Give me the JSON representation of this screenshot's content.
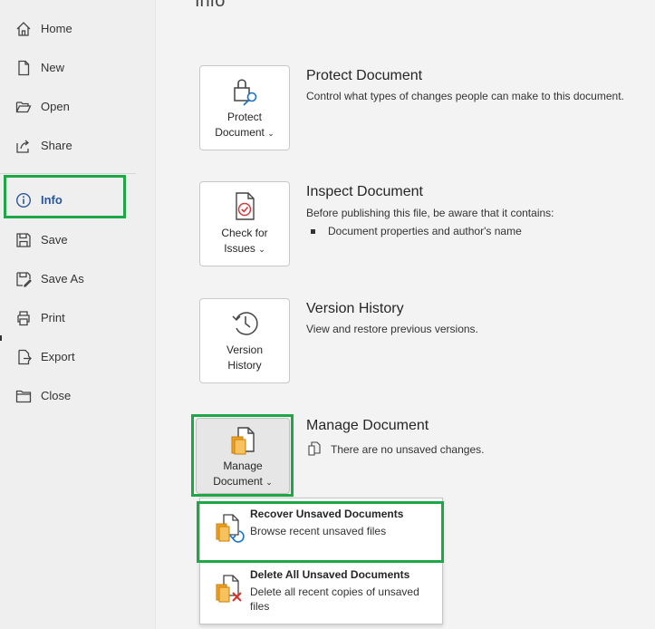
{
  "sidebar": {
    "items": [
      {
        "label": "Home",
        "icon": "home-icon"
      },
      {
        "label": "New",
        "icon": "new-document-icon"
      },
      {
        "label": "Open",
        "icon": "folder-open-icon"
      },
      {
        "label": "Share",
        "icon": "share-icon"
      },
      {
        "label": "Info",
        "icon": "info-icon",
        "active": true
      },
      {
        "label": "Save",
        "icon": "save-icon"
      },
      {
        "label": "Save As",
        "icon": "save-as-icon"
      },
      {
        "label": "Print",
        "icon": "print-icon"
      },
      {
        "label": "Export",
        "icon": "export-icon"
      },
      {
        "label": "Close",
        "icon": "close-folder-icon"
      }
    ]
  },
  "main": {
    "page_title": "Info",
    "sections": {
      "protect": {
        "button_line1": "Protect",
        "button_line2": "Document",
        "title": "Protect Document",
        "description": "Control what types of changes people can make to this document."
      },
      "inspect": {
        "button_line1": "Check for",
        "button_line2": "Issues",
        "title": "Inspect Document",
        "description": "Before publishing this file, be aware that it contains:",
        "bullet": "Document properties and author's name"
      },
      "version": {
        "button_line1": "Version",
        "button_line2": "History",
        "title": "Version History",
        "description": "View and restore previous versions."
      },
      "manage": {
        "button_line1": "Manage",
        "button_line2": "Document",
        "title": "Manage Document",
        "description": "There are no unsaved changes."
      }
    },
    "dropdown": {
      "recover": {
        "title": "Recover Unsaved Documents",
        "description": "Browse recent unsaved files"
      },
      "delete": {
        "title": "Delete All Unsaved Documents",
        "description": "Delete all recent copies of unsaved files"
      }
    }
  },
  "colors": {
    "highlight": "#1fa647",
    "accent": "#2b579a",
    "doc_orange": "#f2a21f",
    "delete_red": "#d93025"
  }
}
